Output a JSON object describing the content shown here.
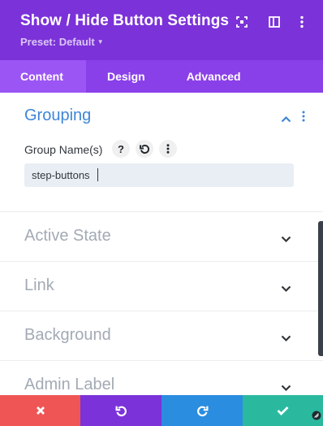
{
  "header": {
    "title": "Show / Hide Button Settings",
    "preset_label": "Preset: Default",
    "icons": [
      "fullscreen-icon",
      "sidebar-toggle-icon",
      "more-options-icon"
    ]
  },
  "tabs": [
    {
      "label": "Content",
      "active": true
    },
    {
      "label": "Design",
      "active": false
    },
    {
      "label": "Advanced",
      "active": false
    }
  ],
  "grouping": {
    "title": "Grouping",
    "expanded": true,
    "field_label": "Group Name(s)",
    "field_value": "step-buttons",
    "field_buttons": [
      "help-icon",
      "reset-icon",
      "field-options-icon"
    ]
  },
  "sections": [
    {
      "title": "Active State"
    },
    {
      "title": "Link"
    },
    {
      "title": "Background"
    },
    {
      "title": "Admin Label"
    }
  ],
  "footer": {
    "buttons": [
      "discard",
      "undo",
      "redo",
      "save"
    ]
  },
  "colors": {
    "header": "#7b32d9",
    "tabs": "#8a40e8",
    "active_tab": "#9b55f5",
    "group_title": "#3f86d6",
    "discard": "#ef5555",
    "undo": "#7b32d9",
    "redo": "#2a8ddf",
    "save": "#2ab99f"
  }
}
